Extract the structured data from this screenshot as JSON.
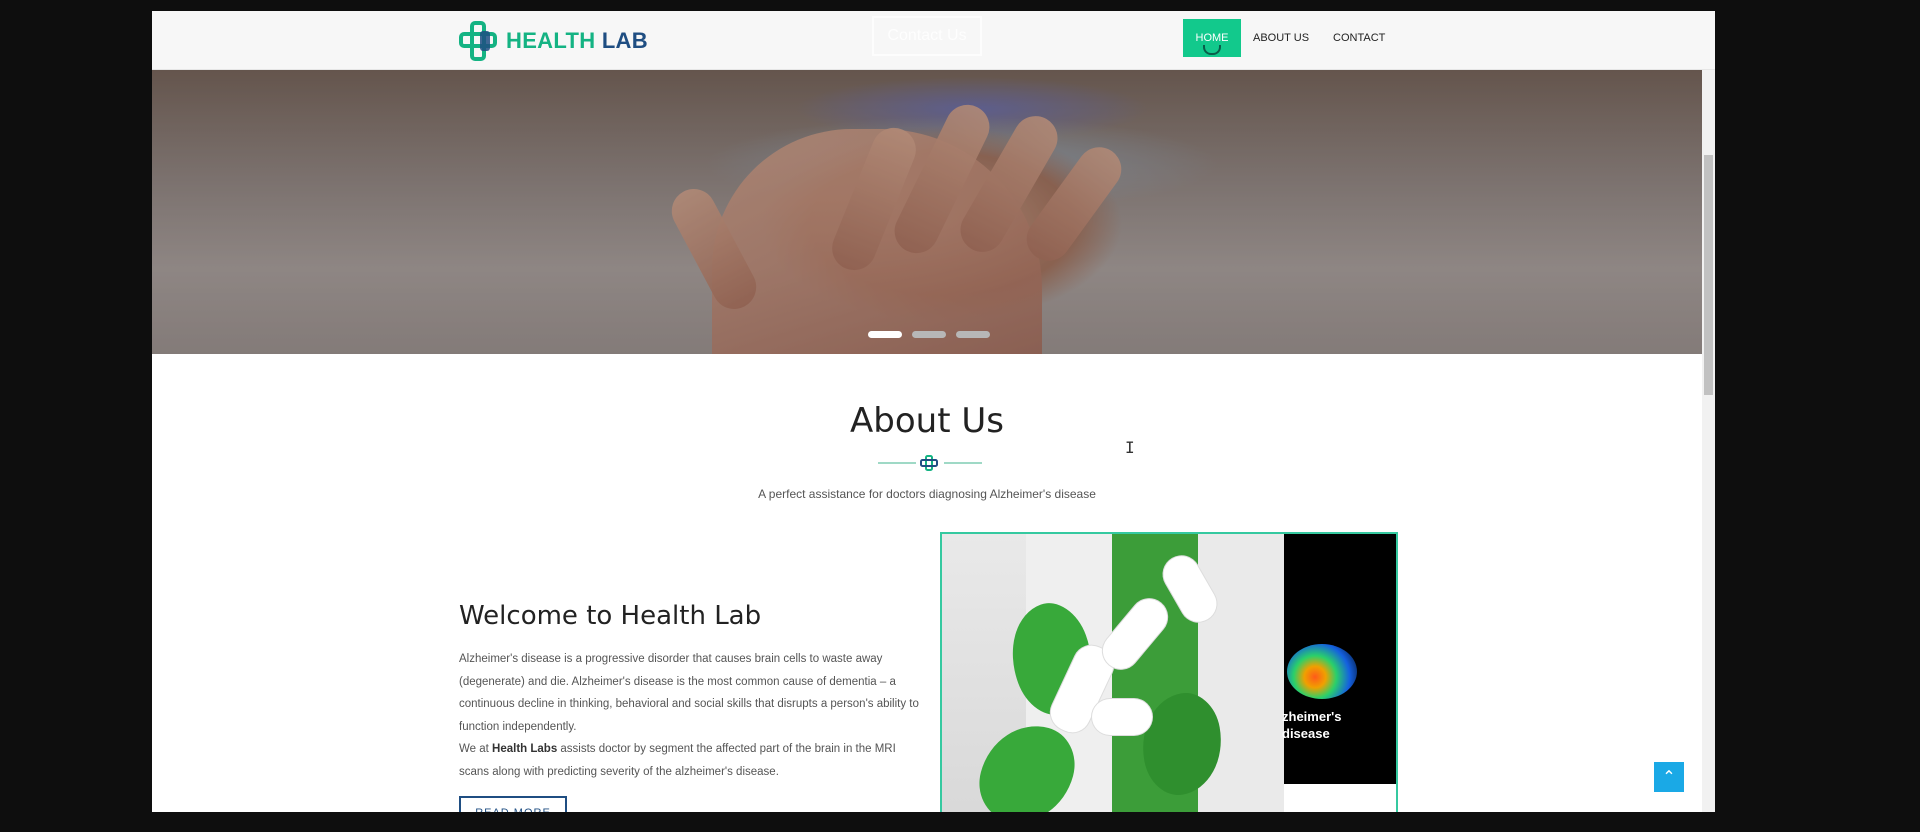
{
  "brand": {
    "logo_part1": "HEALTH",
    "logo_part2": "LAB",
    "green": "#14b383",
    "navy": "#1f4e82"
  },
  "header": {
    "contact_button": "Contact Us",
    "nav": [
      {
        "label": "HOME",
        "active": true
      },
      {
        "label": "ABOUT US",
        "active": false
      },
      {
        "label": "CONTACT",
        "active": false
      }
    ]
  },
  "hero": {
    "slides": 3,
    "active_slide": 1
  },
  "about": {
    "title": "About Us",
    "subtitle": "A perfect assistance for doctors diagnosing Alzheimer's disease",
    "welcome_title": "Welcome to Health Lab",
    "paragraph1": "Alzheimer's disease is a progressive disorder that causes brain cells to waste away (degenerate) and die. Alzheimer's disease is the most common cause of dementia – a continuous decline in thinking, behavioral and social skills that disrupts a person's ability to function independently.",
    "paragraph2_prefix": "We at ",
    "paragraph2_bold": "Health Labs",
    "paragraph2_suffix": " assists doctor by segment the affected part of the brain in the MRI scans along with predicting severity of the alzheimer's disease.",
    "read_more": "READ MORE",
    "image_caption_line1": "zheimer's",
    "image_caption_line2": "disease"
  },
  "ui": {
    "back_to_top_icon": "chevron-up-icon",
    "accent": "#12c98c",
    "back_to_top_color": "#1aa9e6"
  }
}
